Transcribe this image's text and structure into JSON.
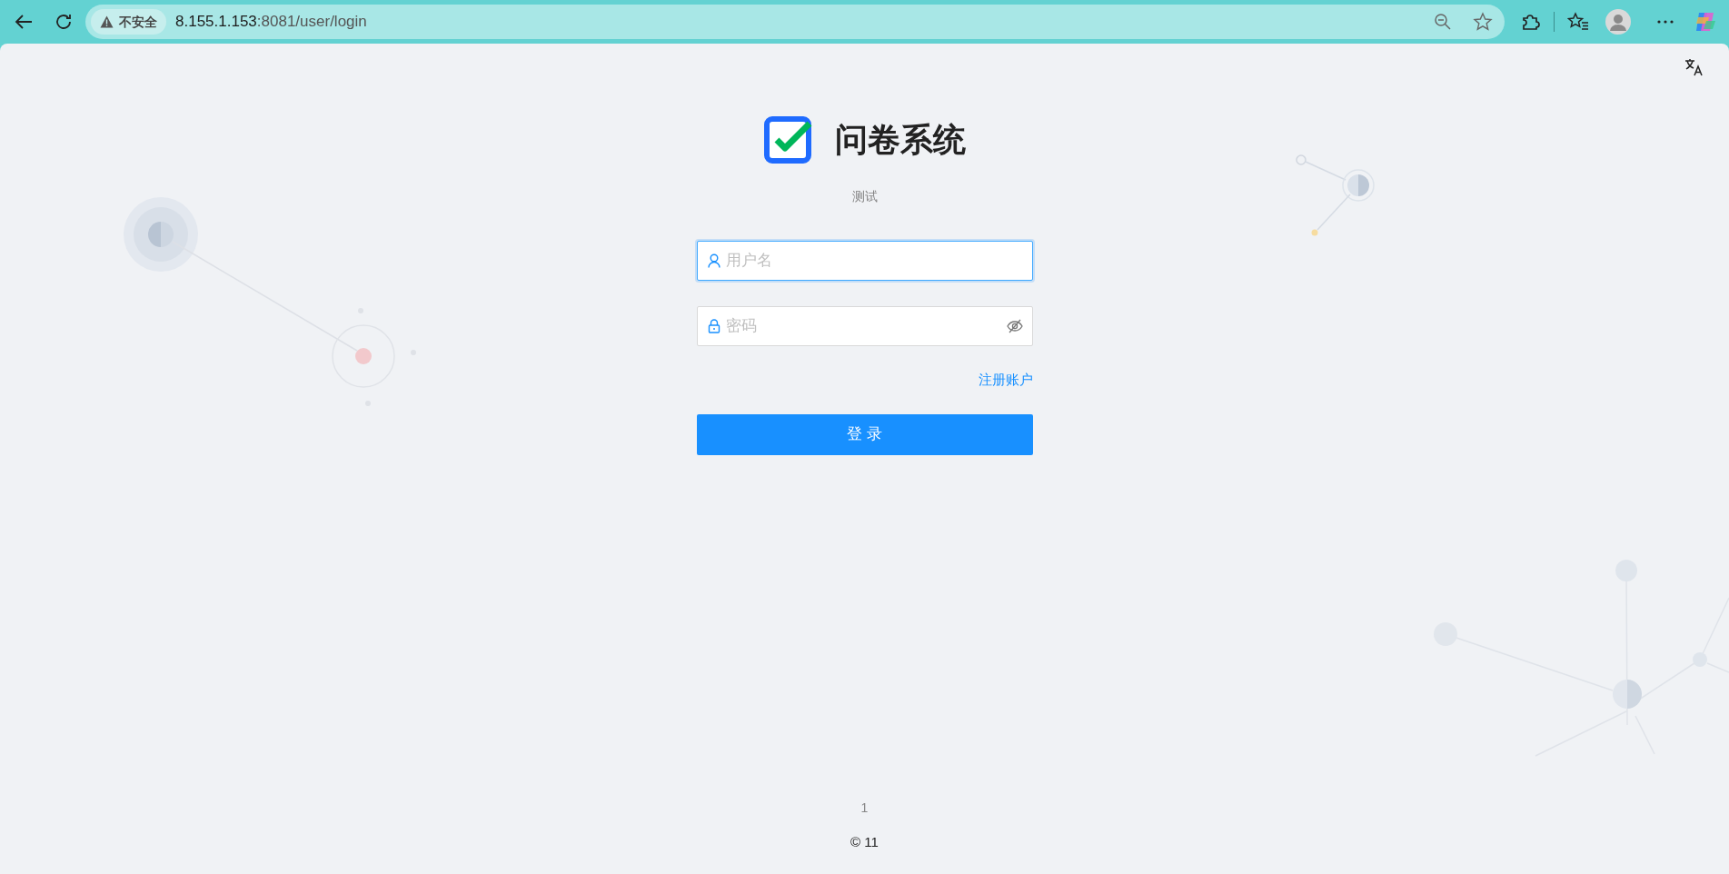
{
  "browser": {
    "security_label": "不安全",
    "url_host": "8.155.1.153",
    "url_rest": ":8081/user/login"
  },
  "header": {
    "title": "问卷系统",
    "subtitle": "测试"
  },
  "form": {
    "fields": [
      {
        "kind": "text",
        "placeholder": "用户名",
        "focused": true
      },
      {
        "kind": "password",
        "placeholder": "密码",
        "focused": false
      }
    ],
    "register_link": "注册账户",
    "submit": "登 录"
  },
  "footer": {
    "line_1": "1",
    "copyright": "© 11"
  }
}
